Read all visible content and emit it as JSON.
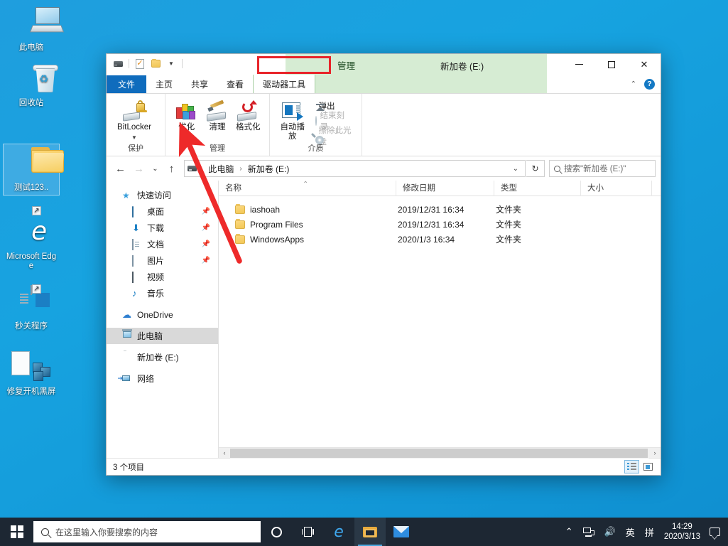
{
  "desktop": {
    "icons": [
      {
        "label": "此电脑",
        "icon": "this-pc-icon",
        "selected": false
      },
      {
        "label": "回收站",
        "icon": "recycle-bin-icon",
        "selected": false
      },
      {
        "label": "测试123..",
        "icon": "folder-icon",
        "selected": true
      },
      {
        "label": "Microsoft Edge",
        "icon": "edge-icon",
        "selected": false
      },
      {
        "label": "秒关程序",
        "icon": "app-window-icon",
        "selected": false
      },
      {
        "label": "修复开机黑屏",
        "icon": "cubes-document-icon",
        "selected": false
      }
    ]
  },
  "explorer": {
    "title": "新加卷 (E:)",
    "contextual_tab_header": "管理",
    "quick_access": [
      {
        "name": "drive-icon"
      },
      {
        "name": "properties-icon"
      },
      {
        "name": "new-folder-icon"
      },
      {
        "name": "chevron-down-icon"
      }
    ],
    "window_controls": {
      "minimize": "—",
      "maximize": "□",
      "close": "✕"
    },
    "tabs": [
      {
        "label": "文件",
        "kind": "file"
      },
      {
        "label": "主页",
        "kind": "normal"
      },
      {
        "label": "共享",
        "kind": "normal"
      },
      {
        "label": "查看",
        "kind": "normal"
      },
      {
        "label": "驱动器工具",
        "kind": "contextual-active"
      }
    ],
    "ribbon_collapse": "⌃",
    "help": "?",
    "ribbon": {
      "groups": [
        {
          "label": "保护",
          "big_buttons": [
            {
              "label": "BitLocker",
              "icon": "bitlocker-icon",
              "has_caret": true
            }
          ],
          "small_buttons": []
        },
        {
          "label": "管理",
          "big_buttons": [
            {
              "label": "优化",
              "icon": "optimize-icon",
              "has_caret": false
            },
            {
              "label": "清理",
              "icon": "cleanup-icon",
              "has_caret": false
            },
            {
              "label": "格式化",
              "icon": "format-icon",
              "has_caret": false
            }
          ],
          "small_buttons": []
        },
        {
          "label": "介质",
          "big_buttons": [
            {
              "label": "自动播放",
              "icon": "autoplay-icon",
              "has_caret": false
            }
          ],
          "small_buttons": [
            {
              "label": "弹出",
              "icon": "eject-icon",
              "disabled": false
            },
            {
              "label": "结束刻录",
              "icon": "disc-icon",
              "disabled": true
            },
            {
              "label": "擦除此光盘",
              "icon": "erase-disc-icon",
              "disabled": true
            }
          ]
        }
      ]
    },
    "navigation": {
      "back": "←",
      "forward": "→",
      "recent": "⌄",
      "up": "↑"
    },
    "address": {
      "drive_icon": "drive-icon",
      "crumbs": [
        "此电脑",
        "新加卷 (E:)"
      ],
      "separator": "›",
      "dropdown": "⌄",
      "refresh": "↻"
    },
    "search": {
      "placeholder": "搜索\"新加卷 (E:)\""
    },
    "nav_pane": [
      {
        "label": "快速访问",
        "icon": "star-icon",
        "level": 0,
        "pinned": false,
        "selected": false
      },
      {
        "label": "桌面",
        "icon": "desktop-icon",
        "level": 1,
        "pinned": true,
        "selected": false
      },
      {
        "label": "下载",
        "icon": "downloads-icon",
        "level": 1,
        "pinned": true,
        "selected": false
      },
      {
        "label": "文档",
        "icon": "documents-icon",
        "level": 1,
        "pinned": true,
        "selected": false
      },
      {
        "label": "图片",
        "icon": "pictures-icon",
        "level": 1,
        "pinned": true,
        "selected": false
      },
      {
        "label": "视频",
        "icon": "videos-icon",
        "level": 1,
        "pinned": false,
        "selected": false
      },
      {
        "label": "音乐",
        "icon": "music-icon",
        "level": 1,
        "pinned": false,
        "selected": false
      },
      {
        "label": "OneDrive",
        "icon": "onedrive-icon",
        "level": 0,
        "pinned": false,
        "selected": false
      },
      {
        "label": "此电脑",
        "icon": "this-pc-icon",
        "level": 0,
        "pinned": false,
        "selected": true
      },
      {
        "label": "新加卷 (E:)",
        "icon": "drive-icon",
        "level": 0,
        "pinned": false,
        "selected": false
      },
      {
        "label": "网络",
        "icon": "network-icon",
        "level": 0,
        "pinned": false,
        "selected": false
      }
    ],
    "columns": [
      {
        "label": "名称",
        "key": "name"
      },
      {
        "label": "修改日期",
        "key": "date"
      },
      {
        "label": "类型",
        "key": "type"
      },
      {
        "label": "大小",
        "key": "size"
      }
    ],
    "sort_indicator": "⌃",
    "files": [
      {
        "name": "iashoah",
        "date": "2019/12/31 16:34",
        "type": "文件夹",
        "size": ""
      },
      {
        "name": "Program Files",
        "date": "2019/12/31 16:34",
        "type": "文件夹",
        "size": ""
      },
      {
        "name": "WindowsApps",
        "date": "2020/1/3 16:34",
        "type": "文件夹",
        "size": ""
      }
    ],
    "scroll": {
      "left_arrow": "‹",
      "right_arrow": "›"
    },
    "status": {
      "item_count": "3 个项目",
      "view_details": "details-view-button",
      "view_icons": "large-icons-view-button"
    }
  },
  "annotation": {
    "color": "#e8242a",
    "arrow_target": "优化",
    "box_target": "管理"
  },
  "taskbar": {
    "start": "start-button",
    "search_placeholder": "在这里输入你要搜索的内容",
    "buttons": [
      {
        "name": "cortana-button",
        "active": false
      },
      {
        "name": "task-view-button",
        "active": false
      },
      {
        "name": "edge-button",
        "active": false
      },
      {
        "name": "file-explorer-button",
        "active": true
      },
      {
        "name": "mail-button",
        "active": false
      }
    ],
    "tray": {
      "expand": "⌃",
      "network": "network-icon",
      "volume": "🔊",
      "ime_lang": "英",
      "ime_mode": "拼",
      "time": "14:29",
      "date": "2020/3/13",
      "action_center": "action-center-icon"
    }
  }
}
